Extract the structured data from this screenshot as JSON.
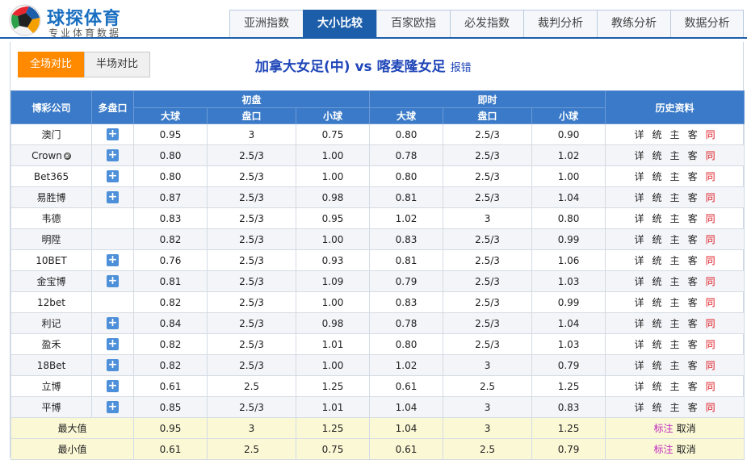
{
  "brand": {
    "title": "球探体育",
    "subtitle": "专业体育数据"
  },
  "nav": [
    {
      "label": "亚洲指数",
      "active": false
    },
    {
      "label": "大小比较",
      "active": true
    },
    {
      "label": "百家欧指",
      "active": false
    },
    {
      "label": "必发指数",
      "active": false
    },
    {
      "label": "裁判分析",
      "active": false
    },
    {
      "label": "教练分析",
      "active": false
    },
    {
      "label": "数据分析",
      "active": false
    }
  ],
  "switch": {
    "full": "全场对比",
    "half": "半场对比"
  },
  "match": {
    "title": "加拿大女足(中) vs 喀麦隆女足",
    "report": "报错"
  },
  "headers": {
    "company": "博彩公司",
    "multi": "多盘口",
    "initial": "初盘",
    "live": "即时",
    "history": "历史资料",
    "over": "大球",
    "line": "盘口",
    "under": "小球"
  },
  "history_links": [
    "详",
    "统",
    "主",
    "客",
    "同"
  ],
  "rows": [
    {
      "company": "澳门",
      "plus": true,
      "crown": false,
      "init": [
        "0.95",
        "3",
        "0.75"
      ],
      "live": [
        "0.80",
        "2.5/3",
        "0.90"
      ]
    },
    {
      "company": "Crown",
      "plus": true,
      "crown": true,
      "init": [
        "0.80",
        "2.5/3",
        "1.00"
      ],
      "live": [
        "0.78",
        "2.5/3",
        "1.02"
      ]
    },
    {
      "company": "Bet365",
      "plus": true,
      "crown": false,
      "init": [
        "0.80",
        "2.5/3",
        "1.00"
      ],
      "live": [
        "0.80",
        "2.5/3",
        "1.00"
      ]
    },
    {
      "company": "易胜博",
      "plus": true,
      "crown": false,
      "init": [
        "0.87",
        "2.5/3",
        "0.98"
      ],
      "live": [
        "0.81",
        "2.5/3",
        "1.04"
      ]
    },
    {
      "company": "韦德",
      "plus": false,
      "crown": false,
      "init": [
        "0.83",
        "2.5/3",
        "0.95"
      ],
      "live": [
        "1.02",
        "3",
        "0.80"
      ]
    },
    {
      "company": "明陞",
      "plus": false,
      "crown": false,
      "init": [
        "0.82",
        "2.5/3",
        "1.00"
      ],
      "live": [
        "0.83",
        "2.5/3",
        "0.99"
      ]
    },
    {
      "company": "10BET",
      "plus": true,
      "crown": false,
      "init": [
        "0.76",
        "2.5/3",
        "0.93"
      ],
      "live": [
        "0.81",
        "2.5/3",
        "1.06"
      ]
    },
    {
      "company": "金宝博",
      "plus": true,
      "crown": false,
      "init": [
        "0.81",
        "2.5/3",
        "1.09"
      ],
      "live": [
        "0.79",
        "2.5/3",
        "1.03"
      ]
    },
    {
      "company": "12bet",
      "plus": false,
      "crown": false,
      "init": [
        "0.82",
        "2.5/3",
        "1.00"
      ],
      "live": [
        "0.83",
        "2.5/3",
        "0.99"
      ]
    },
    {
      "company": "利记",
      "plus": true,
      "crown": false,
      "init": [
        "0.84",
        "2.5/3",
        "0.98"
      ],
      "live": [
        "0.78",
        "2.5/3",
        "1.04"
      ]
    },
    {
      "company": "盈禾",
      "plus": true,
      "crown": false,
      "init": [
        "0.82",
        "2.5/3",
        "1.01"
      ],
      "live": [
        "0.80",
        "2.5/3",
        "1.03"
      ]
    },
    {
      "company": "18Bet",
      "plus": true,
      "crown": false,
      "init": [
        "0.82",
        "2.5/3",
        "1.00"
      ],
      "live": [
        "1.02",
        "3",
        "0.79"
      ]
    },
    {
      "company": "立博",
      "plus": true,
      "crown": false,
      "init": [
        "0.61",
        "2.5",
        "1.25"
      ],
      "live": [
        "0.61",
        "2.5",
        "1.25"
      ]
    },
    {
      "company": "平博",
      "plus": true,
      "crown": false,
      "init": [
        "0.85",
        "2.5/3",
        "1.01"
      ],
      "live": [
        "1.04",
        "3",
        "0.83"
      ]
    }
  ],
  "stats": [
    {
      "label": "最大值",
      "init": [
        "0.95",
        "3",
        "1.25"
      ],
      "live": [
        "1.04",
        "3",
        "1.25"
      ]
    },
    {
      "label": "最小值",
      "init": [
        "0.61",
        "2.5",
        "0.75"
      ],
      "live": [
        "0.61",
        "2.5",
        "0.79"
      ]
    }
  ],
  "stat_actions": {
    "mark": "标注",
    "cancel": "取消"
  },
  "colors": {
    "primary": "#1c5eaa",
    "header": "#3a7ac8",
    "accent": "#ff8a00",
    "stat_bg": "#fbf8d5",
    "red": "#e0141e",
    "mark": "#c028c0"
  }
}
